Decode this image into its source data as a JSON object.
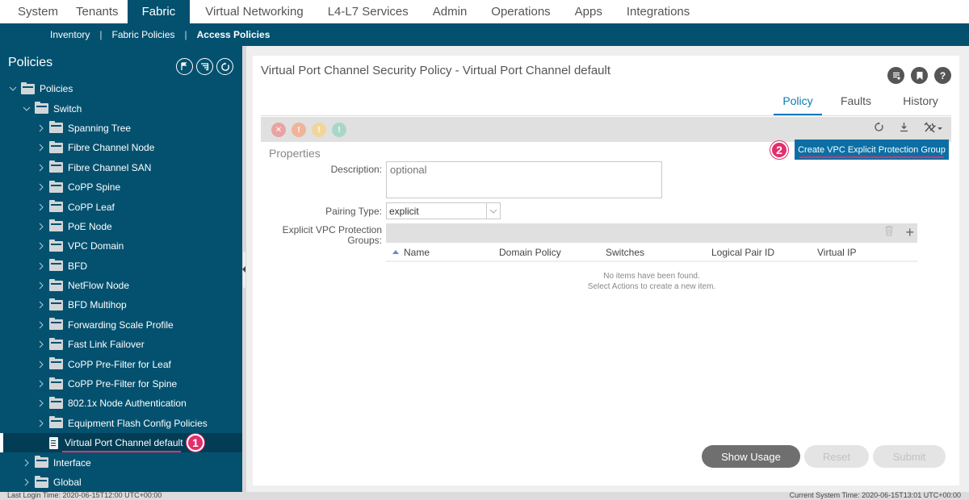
{
  "topnav": {
    "tabs": [
      {
        "label": "System",
        "active": false
      },
      {
        "label": "Tenants",
        "active": false
      },
      {
        "label": "Fabric",
        "active": true
      },
      {
        "label": "Virtual Networking",
        "active": false
      },
      {
        "label": "L4-L7 Services",
        "active": false
      },
      {
        "label": "Admin",
        "active": false
      },
      {
        "label": "Operations",
        "active": false
      },
      {
        "label": "Apps",
        "active": false
      },
      {
        "label": "Integrations",
        "active": false
      }
    ]
  },
  "subnav": {
    "items": [
      {
        "label": "Inventory",
        "active": false
      },
      {
        "label": "Fabric Policies",
        "active": false
      },
      {
        "label": "Access Policies",
        "active": true
      }
    ],
    "separator": "|"
  },
  "sidebar": {
    "title": "Policies",
    "icons": [
      "quick-start-icon",
      "list-filter-icon",
      "refresh-icon"
    ],
    "tree": [
      {
        "label": "Policies",
        "level": 0,
        "expanded": true,
        "type": "folder"
      },
      {
        "label": "Switch",
        "level": 1,
        "expanded": true,
        "type": "folder"
      },
      {
        "label": "Spanning Tree",
        "level": 2,
        "expanded": false,
        "type": "folder"
      },
      {
        "label": "Fibre Channel Node",
        "level": 2,
        "expanded": false,
        "type": "folder"
      },
      {
        "label": "Fibre Channel SAN",
        "level": 2,
        "expanded": false,
        "type": "folder"
      },
      {
        "label": "CoPP Spine",
        "level": 2,
        "expanded": false,
        "type": "folder"
      },
      {
        "label": "CoPP Leaf",
        "level": 2,
        "expanded": false,
        "type": "folder"
      },
      {
        "label": "PoE Node",
        "level": 2,
        "expanded": false,
        "type": "folder"
      },
      {
        "label": "VPC Domain",
        "level": 2,
        "expanded": false,
        "type": "folder"
      },
      {
        "label": "BFD",
        "level": 2,
        "expanded": false,
        "type": "folder"
      },
      {
        "label": "NetFlow Node",
        "level": 2,
        "expanded": false,
        "type": "folder"
      },
      {
        "label": "BFD Multihop",
        "level": 2,
        "expanded": false,
        "type": "folder"
      },
      {
        "label": "Forwarding Scale Profile",
        "level": 2,
        "expanded": false,
        "type": "folder"
      },
      {
        "label": "Fast Link Failover",
        "level": 2,
        "expanded": false,
        "type": "folder"
      },
      {
        "label": "CoPP Pre-Filter for Leaf",
        "level": 2,
        "expanded": false,
        "type": "folder"
      },
      {
        "label": "CoPP Pre-Filter for Spine",
        "level": 2,
        "expanded": false,
        "type": "folder"
      },
      {
        "label": "802.1x Node Authentication",
        "level": 2,
        "expanded": false,
        "type": "folder"
      },
      {
        "label": "Equipment Flash Config Policies",
        "level": 2,
        "expanded": false,
        "type": "folder"
      },
      {
        "label": "Virtual Port Channel default",
        "level": 2,
        "expanded": false,
        "type": "doc",
        "selected": true
      },
      {
        "label": "Interface",
        "level": 1,
        "expanded": false,
        "type": "folder"
      },
      {
        "label": "Global",
        "level": 1,
        "expanded": false,
        "type": "folder"
      }
    ],
    "annotation": "1"
  },
  "main": {
    "title": "Virtual Port Channel Security Policy - Virtual Port Channel default",
    "header_icons": [
      "documentation-icon",
      "bookmark-icon",
      "help-icon"
    ],
    "tabs": [
      {
        "label": "Policy",
        "active": true
      },
      {
        "label": "Faults",
        "active": false
      },
      {
        "label": "History",
        "active": false
      }
    ],
    "fault_icons": [
      {
        "name": "critical-fault-icon",
        "color": "#e8a3a3"
      },
      {
        "name": "major-fault-icon",
        "color": "#f0b49a"
      },
      {
        "name": "minor-fault-icon",
        "color": "#f2d59a"
      },
      {
        "name": "warning-fault-icon",
        "color": "#a9d6c8"
      }
    ],
    "toolbar_actions": [
      "refresh-icon",
      "download-icon",
      "tools-menu-icon"
    ],
    "action_menu_item": "Create VPC Explicit Protection Group",
    "annotation": "2",
    "properties_heading": "Properties",
    "description_label": "Description:",
    "description_placeholder": "optional",
    "description_value": "",
    "pairing_type_label": "Pairing Type:",
    "pairing_type_value": "explicit",
    "groups_label_1": "Explicit VPC Protection",
    "groups_label_2": "Groups:",
    "table": {
      "columns": [
        "Name",
        "Domain Policy",
        "Switches",
        "Logical Pair ID",
        "Virtual IP"
      ],
      "sort_column": "Name",
      "sort_direction": "ascending",
      "rows": [],
      "empty_line_1": "No items have been found.",
      "empty_line_2": "Select Actions to create a new item."
    },
    "buttons": {
      "show_usage": "Show Usage",
      "reset": "Reset",
      "submit": "Submit"
    }
  },
  "status": {
    "last_login": "Last Login Time: 2020-06-15T12:00 UTC+00:00",
    "current_time": "Current System Time: 2020-06-15T13:01 UTC+00:00"
  },
  "colors": {
    "brand": "#04516f",
    "accent": "#0a7ab8",
    "annotation": "#e0306b"
  }
}
